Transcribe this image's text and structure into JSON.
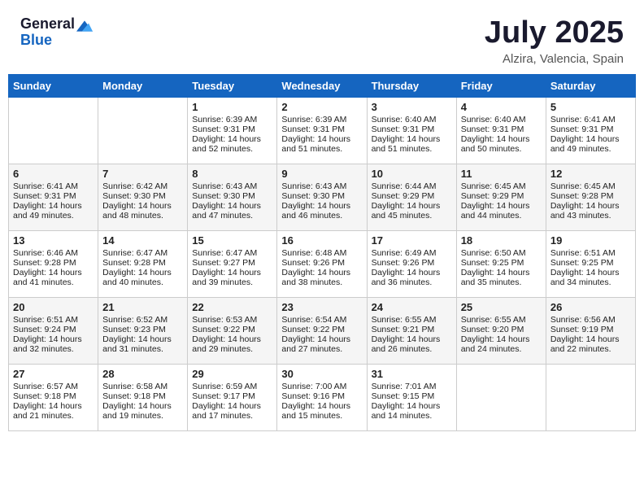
{
  "logo": {
    "general": "General",
    "blue": "Blue"
  },
  "title": "July 2025",
  "location": "Alzira, Valencia, Spain",
  "headers": [
    "Sunday",
    "Monday",
    "Tuesday",
    "Wednesday",
    "Thursday",
    "Friday",
    "Saturday"
  ],
  "weeks": [
    [
      {
        "day": "",
        "sunrise": "",
        "sunset": "",
        "daylight": ""
      },
      {
        "day": "",
        "sunrise": "",
        "sunset": "",
        "daylight": ""
      },
      {
        "day": "1",
        "sunrise": "Sunrise: 6:39 AM",
        "sunset": "Sunset: 9:31 PM",
        "daylight": "Daylight: 14 hours and 52 minutes."
      },
      {
        "day": "2",
        "sunrise": "Sunrise: 6:39 AM",
        "sunset": "Sunset: 9:31 PM",
        "daylight": "Daylight: 14 hours and 51 minutes."
      },
      {
        "day": "3",
        "sunrise": "Sunrise: 6:40 AM",
        "sunset": "Sunset: 9:31 PM",
        "daylight": "Daylight: 14 hours and 51 minutes."
      },
      {
        "day": "4",
        "sunrise": "Sunrise: 6:40 AM",
        "sunset": "Sunset: 9:31 PM",
        "daylight": "Daylight: 14 hours and 50 minutes."
      },
      {
        "day": "5",
        "sunrise": "Sunrise: 6:41 AM",
        "sunset": "Sunset: 9:31 PM",
        "daylight": "Daylight: 14 hours and 49 minutes."
      }
    ],
    [
      {
        "day": "6",
        "sunrise": "Sunrise: 6:41 AM",
        "sunset": "Sunset: 9:31 PM",
        "daylight": "Daylight: 14 hours and 49 minutes."
      },
      {
        "day": "7",
        "sunrise": "Sunrise: 6:42 AM",
        "sunset": "Sunset: 9:30 PM",
        "daylight": "Daylight: 14 hours and 48 minutes."
      },
      {
        "day": "8",
        "sunrise": "Sunrise: 6:43 AM",
        "sunset": "Sunset: 9:30 PM",
        "daylight": "Daylight: 14 hours and 47 minutes."
      },
      {
        "day": "9",
        "sunrise": "Sunrise: 6:43 AM",
        "sunset": "Sunset: 9:30 PM",
        "daylight": "Daylight: 14 hours and 46 minutes."
      },
      {
        "day": "10",
        "sunrise": "Sunrise: 6:44 AM",
        "sunset": "Sunset: 9:29 PM",
        "daylight": "Daylight: 14 hours and 45 minutes."
      },
      {
        "day": "11",
        "sunrise": "Sunrise: 6:45 AM",
        "sunset": "Sunset: 9:29 PM",
        "daylight": "Daylight: 14 hours and 44 minutes."
      },
      {
        "day": "12",
        "sunrise": "Sunrise: 6:45 AM",
        "sunset": "Sunset: 9:28 PM",
        "daylight": "Daylight: 14 hours and 43 minutes."
      }
    ],
    [
      {
        "day": "13",
        "sunrise": "Sunrise: 6:46 AM",
        "sunset": "Sunset: 9:28 PM",
        "daylight": "Daylight: 14 hours and 41 minutes."
      },
      {
        "day": "14",
        "sunrise": "Sunrise: 6:47 AM",
        "sunset": "Sunset: 9:28 PM",
        "daylight": "Daylight: 14 hours and 40 minutes."
      },
      {
        "day": "15",
        "sunrise": "Sunrise: 6:47 AM",
        "sunset": "Sunset: 9:27 PM",
        "daylight": "Daylight: 14 hours and 39 minutes."
      },
      {
        "day": "16",
        "sunrise": "Sunrise: 6:48 AM",
        "sunset": "Sunset: 9:26 PM",
        "daylight": "Daylight: 14 hours and 38 minutes."
      },
      {
        "day": "17",
        "sunrise": "Sunrise: 6:49 AM",
        "sunset": "Sunset: 9:26 PM",
        "daylight": "Daylight: 14 hours and 36 minutes."
      },
      {
        "day": "18",
        "sunrise": "Sunrise: 6:50 AM",
        "sunset": "Sunset: 9:25 PM",
        "daylight": "Daylight: 14 hours and 35 minutes."
      },
      {
        "day": "19",
        "sunrise": "Sunrise: 6:51 AM",
        "sunset": "Sunset: 9:25 PM",
        "daylight": "Daylight: 14 hours and 34 minutes."
      }
    ],
    [
      {
        "day": "20",
        "sunrise": "Sunrise: 6:51 AM",
        "sunset": "Sunset: 9:24 PM",
        "daylight": "Daylight: 14 hours and 32 minutes."
      },
      {
        "day": "21",
        "sunrise": "Sunrise: 6:52 AM",
        "sunset": "Sunset: 9:23 PM",
        "daylight": "Daylight: 14 hours and 31 minutes."
      },
      {
        "day": "22",
        "sunrise": "Sunrise: 6:53 AM",
        "sunset": "Sunset: 9:22 PM",
        "daylight": "Daylight: 14 hours and 29 minutes."
      },
      {
        "day": "23",
        "sunrise": "Sunrise: 6:54 AM",
        "sunset": "Sunset: 9:22 PM",
        "daylight": "Daylight: 14 hours and 27 minutes."
      },
      {
        "day": "24",
        "sunrise": "Sunrise: 6:55 AM",
        "sunset": "Sunset: 9:21 PM",
        "daylight": "Daylight: 14 hours and 26 minutes."
      },
      {
        "day": "25",
        "sunrise": "Sunrise: 6:55 AM",
        "sunset": "Sunset: 9:20 PM",
        "daylight": "Daylight: 14 hours and 24 minutes."
      },
      {
        "day": "26",
        "sunrise": "Sunrise: 6:56 AM",
        "sunset": "Sunset: 9:19 PM",
        "daylight": "Daylight: 14 hours and 22 minutes."
      }
    ],
    [
      {
        "day": "27",
        "sunrise": "Sunrise: 6:57 AM",
        "sunset": "Sunset: 9:18 PM",
        "daylight": "Daylight: 14 hours and 21 minutes."
      },
      {
        "day": "28",
        "sunrise": "Sunrise: 6:58 AM",
        "sunset": "Sunset: 9:18 PM",
        "daylight": "Daylight: 14 hours and 19 minutes."
      },
      {
        "day": "29",
        "sunrise": "Sunrise: 6:59 AM",
        "sunset": "Sunset: 9:17 PM",
        "daylight": "Daylight: 14 hours and 17 minutes."
      },
      {
        "day": "30",
        "sunrise": "Sunrise: 7:00 AM",
        "sunset": "Sunset: 9:16 PM",
        "daylight": "Daylight: 14 hours and 15 minutes."
      },
      {
        "day": "31",
        "sunrise": "Sunrise: 7:01 AM",
        "sunset": "Sunset: 9:15 PM",
        "daylight": "Daylight: 14 hours and 14 minutes."
      },
      {
        "day": "",
        "sunrise": "",
        "sunset": "",
        "daylight": ""
      },
      {
        "day": "",
        "sunrise": "",
        "sunset": "",
        "daylight": ""
      }
    ]
  ]
}
